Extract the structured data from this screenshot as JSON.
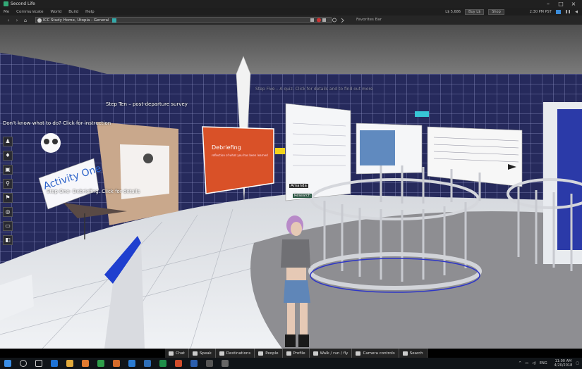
{
  "window": {
    "title": "Second Life",
    "controls": [
      "–",
      "□",
      "×"
    ]
  },
  "menubar": {
    "items": [
      "Me",
      "Communicate",
      "World",
      "Build",
      "Help"
    ],
    "balance": "L$ 5,686",
    "buy_label": "Buy L$",
    "shop_label": "Shop",
    "time": "2:30 PM PST"
  },
  "navbar": {
    "location": "ICC Study Home, Utopia - General",
    "favorites_label": "Favorites Bar"
  },
  "scene": {
    "floating_texts": [
      "Step Ten – post-departure survey",
      "Don't know what to do? Click for instruction",
      "Step One- Debriefing. Click for details",
      "Step Five – A quiz. Click for details and to find out more"
    ],
    "activity_sign": "Activity One",
    "debriefing_board_title": "Debriefing",
    "debriefing_board_sub": "reflection of what you has been learned",
    "avatar_name": "Amanda",
    "avatar_tag": "Research"
  },
  "left_toolbar": {
    "buttons": [
      "avatar-icon",
      "clothing-icon",
      "inventory-icon",
      "search-icon",
      "map-icon",
      "mini-map-icon",
      "camera-icon",
      "snapshot-icon"
    ]
  },
  "bottom_toolbar": {
    "buttons": [
      "Chat",
      "Speak",
      "Destinations",
      "People",
      "Profile",
      "Walk / run / fly",
      "Camera controls",
      "Search"
    ]
  },
  "taskbar": {
    "language": "ENG",
    "time": "11:00 AM",
    "date": "4/20/2018"
  },
  "colors": {
    "accent": "#d95128",
    "solar_blue": "#23275a",
    "floor": "#e4e7eb"
  }
}
